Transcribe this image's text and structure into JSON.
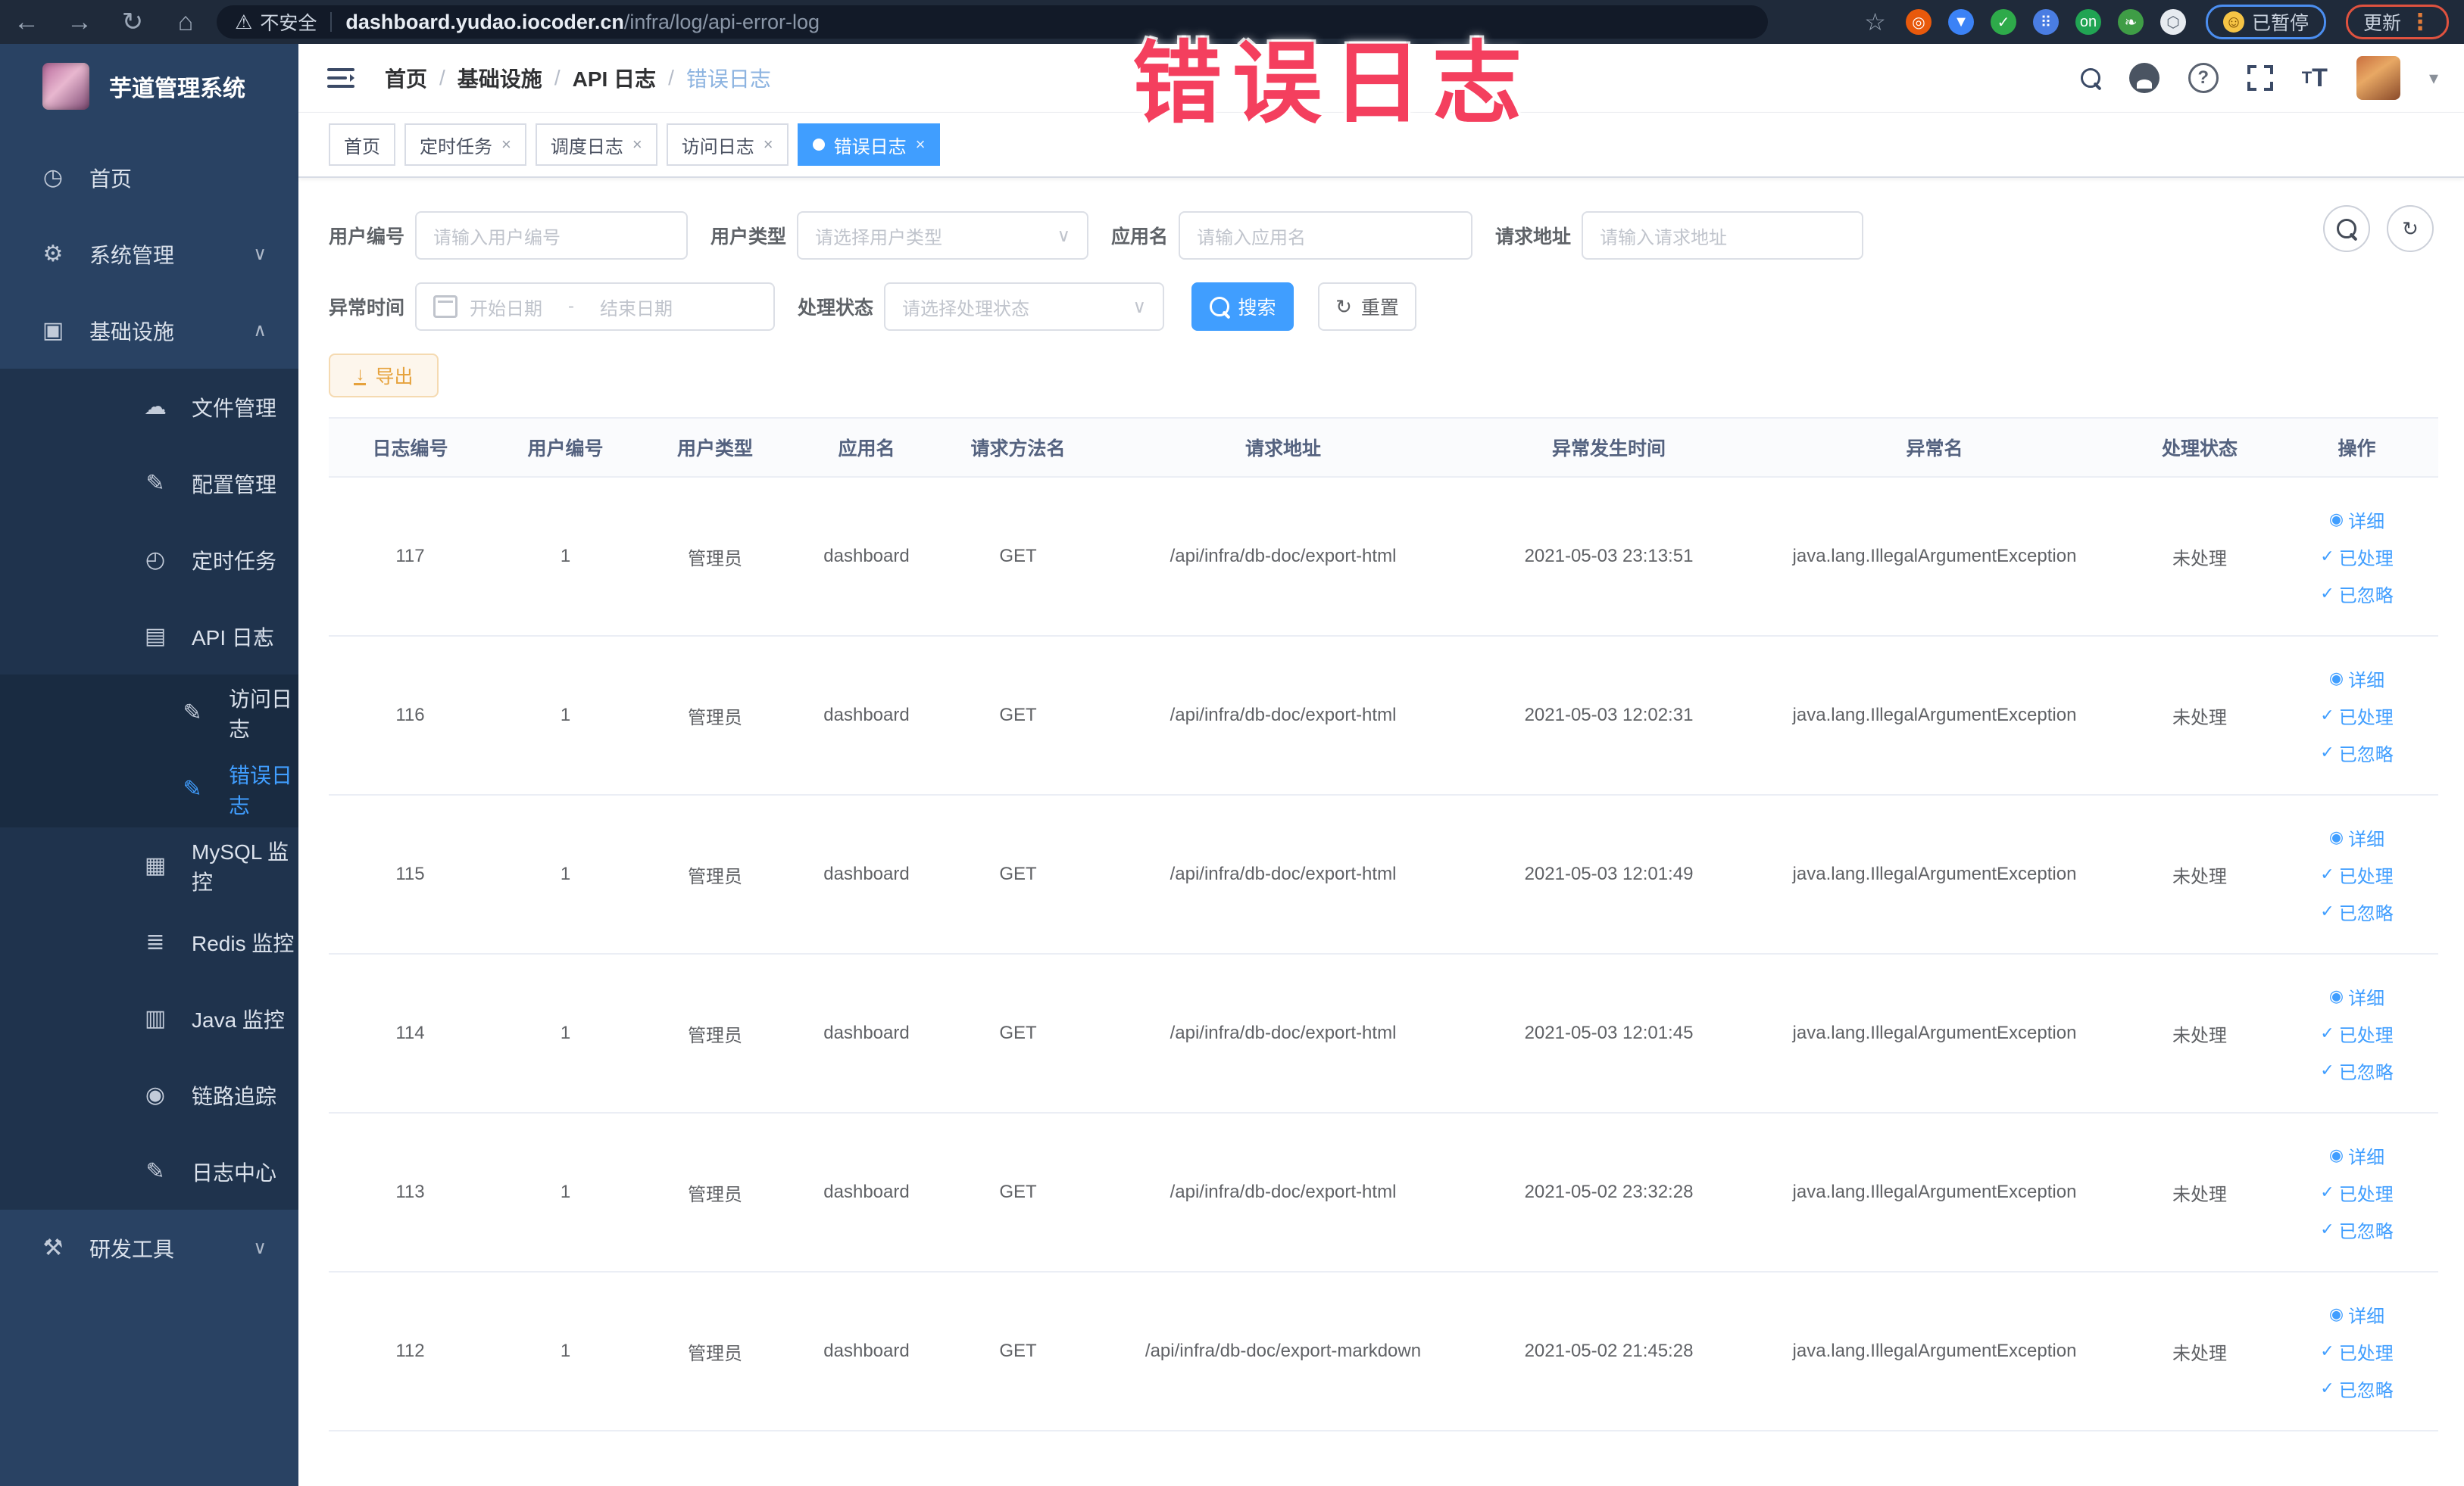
{
  "colors": {
    "accent": "#409eff",
    "warning": "#e6a23c",
    "annotation_pink": "#f43f5e",
    "sidebar_bg": "#294263"
  },
  "browser": {
    "security_label": "不安全",
    "url_host": "dashboard.yudao.iocoder.cn",
    "url_path": "/infra/log/api-error-log",
    "profile_chip_label": "已暂停",
    "update_chip_label": "更新",
    "extensions": [
      {
        "name": "ext-orange-circle",
        "bg": "#e8590c",
        "glyph": "◎"
      },
      {
        "name": "ext-blue-shield",
        "bg": "#3b82f6",
        "glyph": "▼"
      },
      {
        "name": "ext-green-check",
        "bg": "#2eaa4a",
        "glyph": "✓"
      },
      {
        "name": "ext-blue-grid",
        "bg": "#4a7de2",
        "glyph": "⠿"
      },
      {
        "name": "ext-green-on",
        "bg": "#21a453",
        "glyph": "on"
      },
      {
        "name": "ext-green-leaf",
        "bg": "#3f9d46",
        "glyph": "❧"
      },
      {
        "name": "ext-puzzle",
        "bg": "#e7ebf0",
        "glyph": "⬡"
      }
    ]
  },
  "annotation": {
    "text": "错误日志"
  },
  "sidebar": {
    "title": "芋道管理系统",
    "items": [
      {
        "label": "首页",
        "icon": "dashboard-icon",
        "glyph": "◷",
        "level": 0
      },
      {
        "label": "系统管理",
        "icon": "gear-icon",
        "glyph": "⚙",
        "level": 0,
        "chevron": "down"
      },
      {
        "label": "基础设施",
        "icon": "infra-icon",
        "glyph": "▣",
        "level": 0,
        "chevron": "up"
      },
      {
        "label": "文件管理",
        "icon": "file-upload-icon",
        "glyph": "☁",
        "level": 1
      },
      {
        "label": "配置管理",
        "icon": "config-icon",
        "glyph": "✎",
        "level": 1
      },
      {
        "label": "定时任务",
        "icon": "job-icon",
        "glyph": "◴",
        "level": 1
      },
      {
        "label": "API 日志",
        "icon": "api-log-icon",
        "glyph": "▤",
        "level": 1,
        "chevron": "up"
      },
      {
        "label": "访问日志",
        "icon": "access-log-icon",
        "glyph": "✎",
        "level": 2
      },
      {
        "label": "错误日志",
        "icon": "error-log-icon",
        "glyph": "✎",
        "level": 2,
        "active": true
      },
      {
        "label": "MySQL 监控",
        "icon": "mysql-icon",
        "glyph": "▦",
        "level": 1
      },
      {
        "label": "Redis 监控",
        "icon": "redis-icon",
        "glyph": "≣",
        "level": 1
      },
      {
        "label": "Java 监控",
        "icon": "java-icon",
        "glyph": "▥",
        "level": 1
      },
      {
        "label": "链路追踪",
        "icon": "trace-icon",
        "glyph": "◉",
        "level": 1
      },
      {
        "label": "日志中心",
        "icon": "log-center-icon",
        "glyph": "✎",
        "level": 1
      },
      {
        "label": "研发工具",
        "icon": "tools-icon",
        "glyph": "⚒",
        "level": 0,
        "chevron": "down"
      }
    ]
  },
  "header": {
    "breadcrumb": [
      "首页",
      "基础设施",
      "API 日志",
      "错误日志"
    ]
  },
  "tabs": [
    {
      "label": "首页",
      "closable": false,
      "active": false
    },
    {
      "label": "定时任务",
      "closable": true,
      "active": false
    },
    {
      "label": "调度日志",
      "closable": true,
      "active": false
    },
    {
      "label": "访问日志",
      "closable": true,
      "active": false
    },
    {
      "label": "错误日志",
      "closable": true,
      "active": true
    }
  ],
  "filters": {
    "user_id": {
      "label": "用户编号",
      "placeholder": "请输入用户编号"
    },
    "user_type": {
      "label": "用户类型",
      "placeholder": "请选择用户类型"
    },
    "app_name": {
      "label": "应用名",
      "placeholder": "请输入应用名"
    },
    "request_url": {
      "label": "请求地址",
      "placeholder": "请输入请求地址"
    },
    "exception_time": {
      "label": "异常时间",
      "start_placeholder": "开始日期",
      "separator": "-",
      "end_placeholder": "结束日期"
    },
    "process_status": {
      "label": "处理状态",
      "placeholder": "请选择处理状态"
    },
    "search_label": "搜索",
    "reset_label": "重置"
  },
  "toolbar": {
    "export_label": "导出"
  },
  "table": {
    "headers": [
      "日志编号",
      "用户编号",
      "用户类型",
      "应用名",
      "请求方法名",
      "请求地址",
      "异常发生时间",
      "异常名",
      "处理状态",
      "操作"
    ],
    "actions": [
      {
        "label": "详细",
        "icon": "eye-icon",
        "glyph": "◉"
      },
      {
        "label": "已处理",
        "icon": "check-icon",
        "glyph": "✓"
      },
      {
        "label": "已忽略",
        "icon": "check-icon",
        "glyph": "✓"
      }
    ],
    "rows": [
      {
        "log_id": "117",
        "user_id": "1",
        "user_type": "管理员",
        "app_name": "dashboard",
        "method": "GET",
        "url": "/api/infra/db-doc/export-html",
        "time": "2021-05-03 23:13:51",
        "exception": "java.lang.IllegalArgumentException",
        "status": "未处理"
      },
      {
        "log_id": "116",
        "user_id": "1",
        "user_type": "管理员",
        "app_name": "dashboard",
        "method": "GET",
        "url": "/api/infra/db-doc/export-html",
        "time": "2021-05-03 12:02:31",
        "exception": "java.lang.IllegalArgumentException",
        "status": "未处理"
      },
      {
        "log_id": "115",
        "user_id": "1",
        "user_type": "管理员",
        "app_name": "dashboard",
        "method": "GET",
        "url": "/api/infra/db-doc/export-html",
        "time": "2021-05-03 12:01:49",
        "exception": "java.lang.IllegalArgumentException",
        "status": "未处理"
      },
      {
        "log_id": "114",
        "user_id": "1",
        "user_type": "管理员",
        "app_name": "dashboard",
        "method": "GET",
        "url": "/api/infra/db-doc/export-html",
        "time": "2021-05-03 12:01:45",
        "exception": "java.lang.IllegalArgumentException",
        "status": "未处理"
      },
      {
        "log_id": "113",
        "user_id": "1",
        "user_type": "管理员",
        "app_name": "dashboard",
        "method": "GET",
        "url": "/api/infra/db-doc/export-html",
        "time": "2021-05-02 23:32:28",
        "exception": "java.lang.IllegalArgumentException",
        "status": "未处理"
      },
      {
        "log_id": "112",
        "user_id": "1",
        "user_type": "管理员",
        "app_name": "dashboard",
        "method": "GET",
        "url": "/api/infra/db-doc/export-markdown",
        "time": "2021-05-02 21:45:28",
        "exception": "java.lang.IllegalArgumentException",
        "status": "未处理"
      }
    ]
  }
}
